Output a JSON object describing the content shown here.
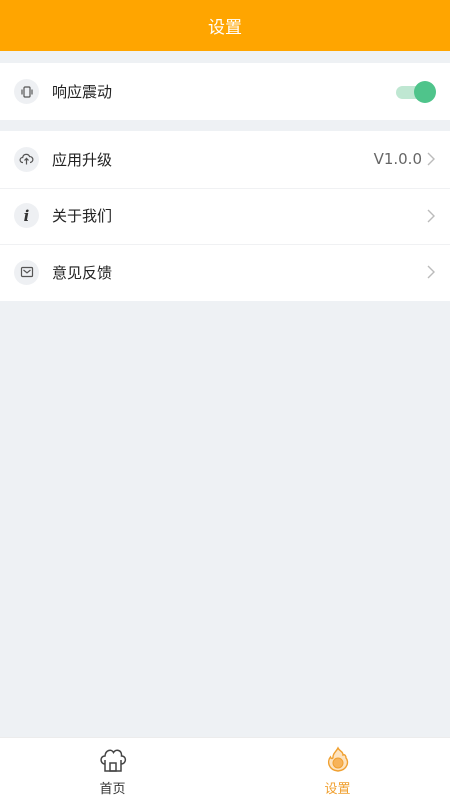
{
  "header": {
    "title": "设置"
  },
  "settings": {
    "vibration": {
      "label": "响应震动",
      "icon": "vibrate-icon",
      "enabled": true
    },
    "upgrade": {
      "label": "应用升级",
      "icon": "cloud-upload-icon",
      "value": "V1.0.0"
    },
    "about": {
      "label": "关于我们",
      "icon": "info-icon",
      "info_glyph": "i"
    },
    "feedback": {
      "label": "意见反馈",
      "icon": "mail-icon"
    }
  },
  "tabbar": {
    "tabs": [
      {
        "label": "首页",
        "icon": "chef-hat-home-icon",
        "active": false
      },
      {
        "label": "设置",
        "icon": "flame-settings-icon",
        "active": true
      }
    ]
  },
  "colors": {
    "accent": "#ffa500",
    "toggle_on": "#4fc48b",
    "active_tab": "#f0a030"
  }
}
